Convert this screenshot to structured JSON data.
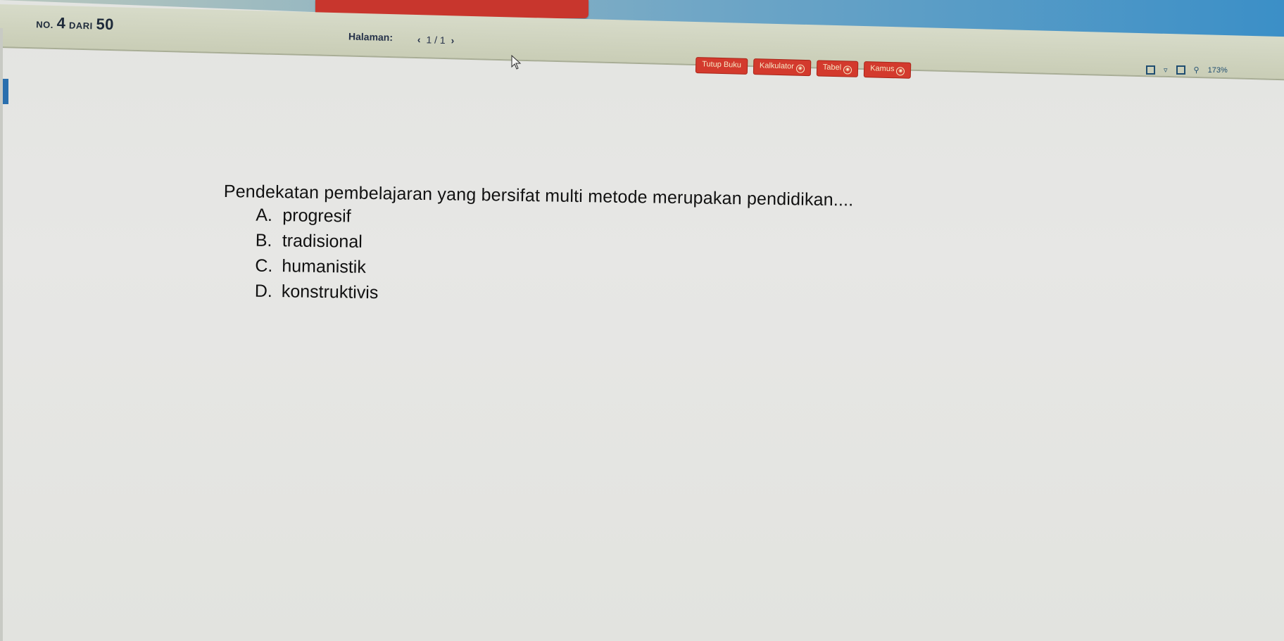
{
  "header": {
    "question_no_prefix": "NO.",
    "question_no": "4",
    "question_of": "DARI",
    "question_total": "50",
    "page_label": "Halaman:",
    "page_prev": "‹",
    "page_value": "1 / 1",
    "page_next": "›",
    "zoom_text": "173%"
  },
  "tools": {
    "close_book": "Tutup Buku",
    "calculator": "Kalkulator",
    "table": "Tabel",
    "dictionary": "Kamus"
  },
  "question": {
    "text": "Pendekatan pembelajaran yang bersifat multi metode merupakan pendidikan....",
    "options": [
      {
        "letter": "A.",
        "text": "progresif"
      },
      {
        "letter": "B.",
        "text": "tradisional"
      },
      {
        "letter": "C.",
        "text": "humanistik"
      },
      {
        "letter": "D.",
        "text": "konstruktivis"
      }
    ]
  },
  "colors": {
    "accent_red": "#d33a2d",
    "header_bg": "#c9cdb6",
    "brand_blue": "#3b8fc7"
  },
  "icons": {
    "cursor": "mouse-pointer-icon",
    "zoom": "magnifier-icon"
  }
}
